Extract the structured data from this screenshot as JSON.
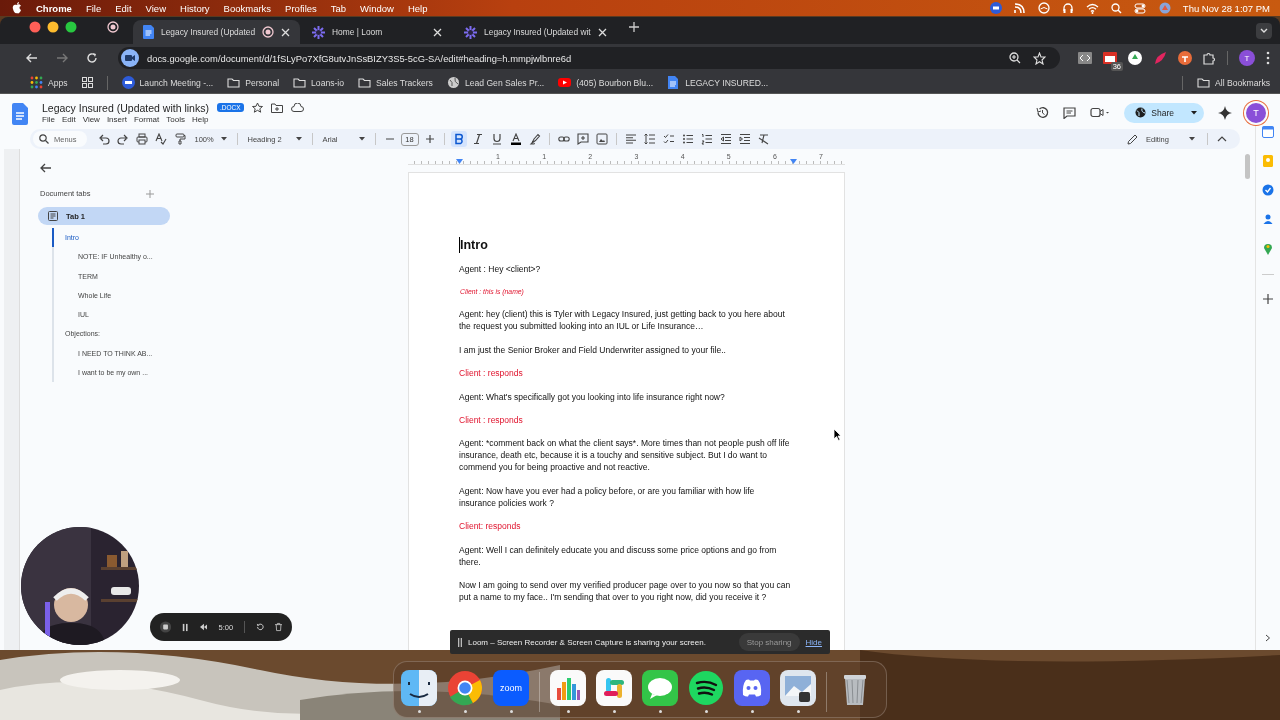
{
  "menubar": {
    "app": "Chrome",
    "menus": [
      "File",
      "Edit",
      "View",
      "History",
      "Bookmarks",
      "Profiles",
      "Tab",
      "Window",
      "Help"
    ],
    "clock": "Thu Nov 28  1:07 PM"
  },
  "browser": {
    "tabs": [
      {
        "title": "Legacy Insured (Updated",
        "kind": "docs",
        "selected": true,
        "recording": true
      },
      {
        "title": "Home | Loom",
        "kind": "loom",
        "selected": false,
        "recording": false
      },
      {
        "title": "Legacy Insured (Updated wit",
        "kind": "loom",
        "selected": false,
        "recording": false
      }
    ],
    "address": "docs.google.com/document/d/1fSLyPo7XfG8utvJnSsBIZY3S5-5cG-SA/edit#heading=h.mmpjwlbnre6d",
    "extension_badge": "36",
    "profile_initial": "T",
    "bookmarks": [
      {
        "label": "Apps",
        "kind": "apps"
      },
      {
        "label": "Launch Meeting -...",
        "kind": "zoom"
      },
      {
        "label": "Personal",
        "kind": "folder"
      },
      {
        "label": "Loans-io",
        "kind": "folder"
      },
      {
        "label": "Sales Trackers",
        "kind": "folder"
      },
      {
        "label": "Lead Gen Sales Pr...",
        "kind": "globe"
      },
      {
        "label": "(405) Bourbon Blu...",
        "kind": "video"
      },
      {
        "label": "LEGACY INSURED...",
        "kind": "docs"
      }
    ],
    "all_bookmarks": "All Bookmarks"
  },
  "docs": {
    "title": "Legacy Insured (Updated with links)",
    "badge": ".DOCX",
    "menus": [
      "File",
      "Edit",
      "View",
      "Insert",
      "Format",
      "Tools",
      "Help"
    ],
    "share": "Share",
    "avatar": "T",
    "toolbar": {
      "search": "Menus",
      "zoom": "100%",
      "style": "Heading 2",
      "font": "Arial",
      "size": "18",
      "bold": true,
      "mode": "Editing"
    },
    "ruler": [
      "1",
      "1",
      "2",
      "3",
      "4",
      "5",
      "6",
      "7"
    ]
  },
  "sidebar": {
    "heading": "Document tabs",
    "tabs": [
      {
        "label": "Tab 1",
        "selected": true,
        "outline": [
          {
            "label": "Intro",
            "selected": true,
            "children": [
              {
                "label": "NOTE: IF Unhealthy o...",
                "selected": false
              },
              {
                "label": "TERM",
                "selected": false
              },
              {
                "label": "Whole Life",
                "selected": false
              },
              {
                "label": "IUL",
                "selected": false
              }
            ]
          },
          {
            "label": "Objections:",
            "selected": false,
            "children": [
              {
                "label": "I NEED TO THINK AB...",
                "selected": false
              },
              {
                "label": "I want to be my own ...",
                "selected": false
              }
            ]
          }
        ]
      }
    ]
  },
  "document": {
    "paragraphs": [
      {
        "kind": "heading",
        "text": "Intro"
      },
      {
        "kind": "text",
        "text": "Agent : Hey <client>?"
      },
      {
        "kind": "note",
        "text": "Client : this is (name)"
      },
      {
        "kind": "text",
        "text": "Agent: hey (client) this is Tyler with Legacy Insured, just getting back to you here about the request you submitted looking into an IUL or Life Insurance…"
      },
      {
        "kind": "text",
        "text": "I am just the Senior Broker and Field Underwriter assigned to your file.."
      },
      {
        "kind": "client",
        "text": "Client : responds"
      },
      {
        "kind": "text",
        "text": "Agent: What's specifically got you looking into life insurance right now?"
      },
      {
        "kind": "client",
        "text": "Client : responds"
      },
      {
        "kind": "text",
        "text": "Agent: *comment back on what the client says*. More times than not people push off life insurance, death etc, because it is a touchy and sensitive subject. But I do want to commend you for being proactive and not reactive."
      },
      {
        "kind": "text",
        "text": "Agent: Now have you ever had a policy before, or are you familiar with how life insurance policies work ?"
      },
      {
        "kind": "client",
        "text": "Client: responds"
      },
      {
        "kind": "text",
        "text": "Agent: Well I can definitely educate you and discuss some price options and go from there."
      },
      {
        "kind": "text",
        "text": "Now I am going to send over my verified producer page over to you now so that you can put a name to my face..  I'm sending that over to you right now, did you receive it ?"
      }
    ]
  },
  "loom": {
    "message": "Loom – Screen Recorder & Screen Capture is sharing your screen.",
    "stop": "Stop sharing",
    "hide": "Hide",
    "timer": "5:00"
  },
  "dock": [
    {
      "kind": "finder",
      "running": true
    },
    {
      "kind": "chrome",
      "running": true
    },
    {
      "kind": "zoom",
      "label": "zoom",
      "running": true
    },
    {
      "kind": "numbers",
      "running": true
    },
    {
      "kind": "slack",
      "running": true
    },
    {
      "kind": "messages",
      "running": true
    },
    {
      "kind": "spotify",
      "running": true
    },
    {
      "kind": "discord",
      "running": true
    },
    {
      "kind": "preview",
      "running": true
    },
    {
      "kind": "trash",
      "running": false
    }
  ]
}
